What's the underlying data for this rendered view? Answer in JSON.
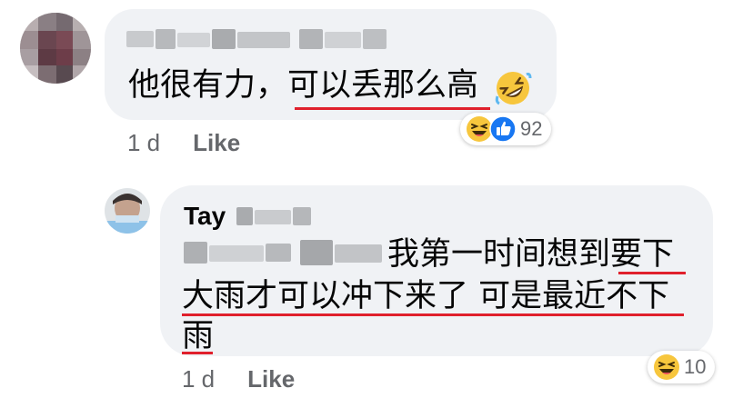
{
  "comment1": {
    "text": "他很有力，可以丢那么高",
    "meta": {
      "time": "1 d",
      "like_label": "Like"
    },
    "reactions": {
      "icons": [
        "haha-icon",
        "like-icon"
      ],
      "count": "92"
    },
    "inline_emoji": "rolling-on-floor-laughing-icon"
  },
  "reply1": {
    "author_first": "Tay",
    "lines": [
      "我第一时间想到要下",
      "大雨才可以冲下来了 可是最近不下",
      "雨"
    ],
    "meta": {
      "time": "1 d",
      "like_label": "Like"
    },
    "reactions": {
      "icons": [
        "haha-icon"
      ],
      "count": "10"
    }
  },
  "colors": {
    "bubble": "#f0f2f5",
    "meta_text": "#65676b",
    "underline": "#e0202c",
    "like_blue": "#1877f2",
    "haha_yellow": "#f7c63d"
  }
}
